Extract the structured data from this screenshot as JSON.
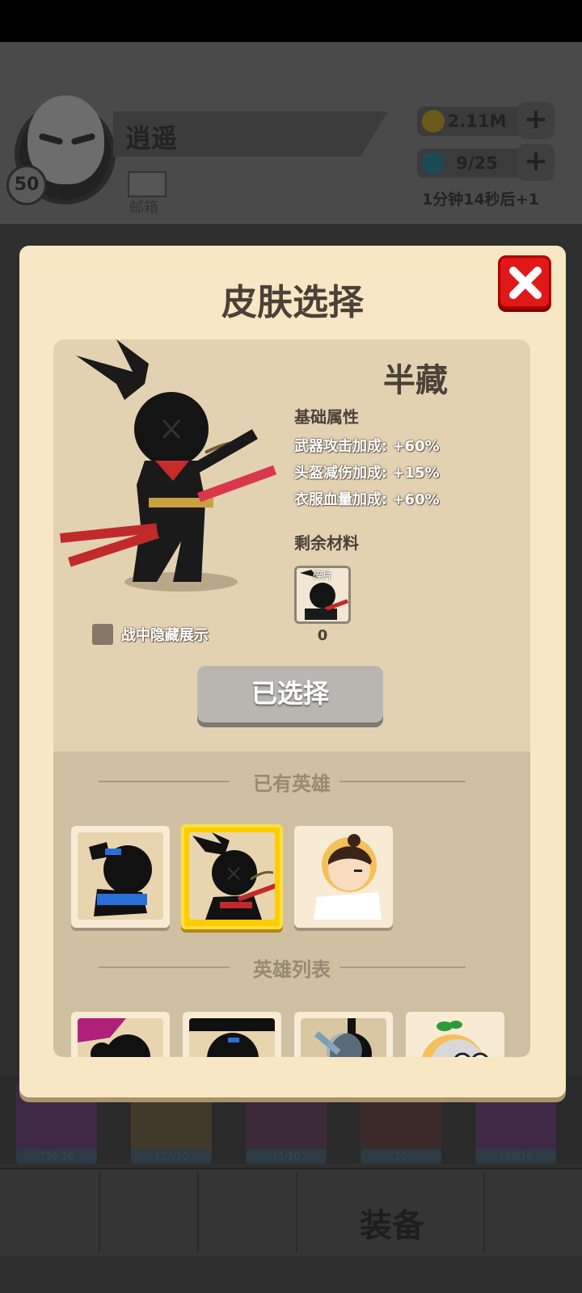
{
  "header": {
    "level": "50",
    "player_name": "逍遥",
    "mailbox_label": "邮箱",
    "gold": "2.11M",
    "energy": "9/25",
    "energy_timer": "1分钟14秒后+1",
    "plus_label": "+"
  },
  "bottom": {
    "slots": [
      "750/10",
      "127/10",
      "11/10",
      "10",
      "160/10"
    ],
    "equip_label": "装备"
  },
  "modal": {
    "title": "皮肤选择",
    "skin_name": "半藏",
    "base_attr_title": "基础属性",
    "attributes": [
      "武器攻击加成: +60%",
      "头盔减伤加成: +15%",
      "衣服血量加成: +60%"
    ],
    "material_title": "剩余材料",
    "material_card_label": "碎片",
    "material_count": "0",
    "hide_in_battle_label": "战中隐藏展示",
    "selected_button": "已选择",
    "owned_section": "已有英雄",
    "list_section": "英雄列表"
  },
  "colors": {
    "modal_bg": "#f8e7c4",
    "panel_bg": "#e2d2b2",
    "close_red": "#e11818",
    "selected_gold": "#ffcc00",
    "button_gray": "#b9b6b2"
  }
}
